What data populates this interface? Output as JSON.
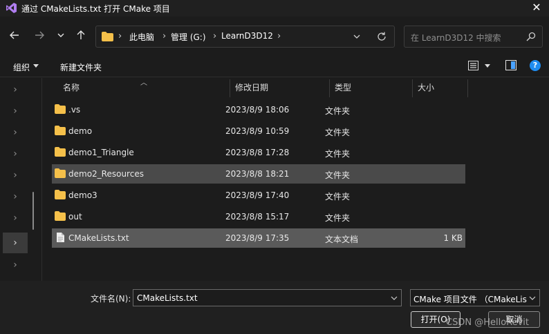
{
  "window": {
    "title": "通过 CMakeLists.txt 打开 CMake 项目",
    "close_glyph": "✕"
  },
  "nav": {
    "breadcrumbs": [
      "此电脑",
      "管理 (G:)",
      "LearnD3D12"
    ],
    "search_placeholder": "在 LearnD3D12 中搜索"
  },
  "toolbar": {
    "organize_label": "组织",
    "new_folder_label": "新建文件夹",
    "help_glyph": "?"
  },
  "columns": {
    "name": "名称",
    "modified": "修改日期",
    "type": "类型",
    "size": "大小"
  },
  "files": [
    {
      "name": ".vs",
      "modified": "2023/8/9 18:06",
      "type": "文件夹",
      "size": "",
      "icon": "folder-icon"
    },
    {
      "name": "demo",
      "modified": "2023/8/9 10:59",
      "type": "文件夹",
      "size": "",
      "icon": "folder-icon"
    },
    {
      "name": "demo1_Triangle",
      "modified": "2023/8/8 17:28",
      "type": "文件夹",
      "size": "",
      "icon": "folder-icon"
    },
    {
      "name": "demo2_Resources",
      "modified": "2023/8/8 18:21",
      "type": "文件夹",
      "size": "",
      "icon": "folder-icon"
    },
    {
      "name": "demo3",
      "modified": "2023/8/9 17:40",
      "type": "文件夹",
      "size": "",
      "icon": "folder-icon"
    },
    {
      "name": "out",
      "modified": "2023/8/8 15:17",
      "type": "文件夹",
      "size": "",
      "icon": "folder-icon"
    },
    {
      "name": "CMakeLists.txt",
      "modified": "2023/8/9 17:35",
      "type": "文本文档",
      "size": "1 KB",
      "icon": "text-file-icon"
    }
  ],
  "footer": {
    "filename_label": "文件名(N):",
    "filename_value": "CMakeLists.txt",
    "filter_value": "CMake 项目文件 （CMakeLis",
    "open_label": "打开(O)",
    "cancel_label": "取消"
  },
  "watermark": "CSDN @HelloRevit",
  "colors": {
    "folder": "#f5c04a",
    "accent": "#1f8cf0",
    "selected_row": "#5a5a5a",
    "hover_row": "#4a4a4a"
  }
}
